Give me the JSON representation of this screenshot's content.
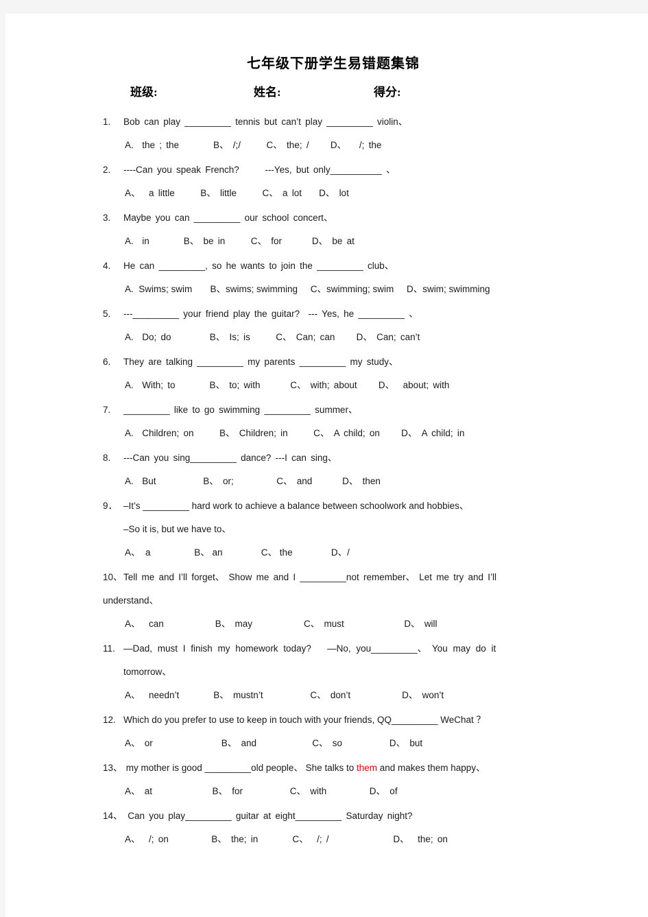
{
  "document": {
    "title": "七年级下册学生易错题集锦",
    "header_fields": {
      "class_label": "班级:",
      "name_label": "姓名:",
      "score_label": "得分:"
    }
  },
  "questions": [
    {
      "number": "1.",
      "stem": "Bob can play _________ tennis but can’t play _________ violin、",
      "options": "A.  the ; the        B、 /;/      C、 the; /     D、   /; the"
    },
    {
      "number": "2.",
      "stem": "----Can you speak French?      ---Yes, but only__________ 、",
      "options": "A、  a little      B、 little      C、 a lot    D、 lot"
    },
    {
      "number": "3.",
      "stem": "Maybe you can _________ our school concert、",
      "options": "A.  in        B、 be in      C、 for       D、 be at"
    },
    {
      "number": "4.",
      "stem": "He can _________, so he wants to join the _________ club、",
      "options": "A.  Swims; swim       B、swims; swimming     C、swimming; swim     D、swim; swimming"
    },
    {
      "number": "5.",
      "stem": "---_________ your friend play the guitar?  --- Yes, he _________ 、",
      "options": "A.  Do; do         B、 Is; is      C、 Can; can     D、 Can; can’t"
    },
    {
      "number": "6.",
      "stem": "They are talking _________ my parents _________ my study、",
      "options": "A.  With; to        B、 to; with       C、 with; about     D、  about; with"
    },
    {
      "number": "7.",
      "stem": "_________ like to go swimming _________ summer、",
      "options": "A.  Children; on      B、 Children; in      C、 A child; on     D、 A child; in"
    },
    {
      "number": "8.",
      "stem": "---Can you sing_________ dance? ---I can sing、",
      "options": "A.  But           B、 or;          C、 and       D、 then"
    },
    {
      "number": "9．",
      "stem": "–It’s _________ hard work to achieve a balance between schoolwork and hobbies、",
      "stem_line2": "–So it is, but we have to、",
      "options": "A、  a                 B、 an               C、 the               D、/"
    },
    {
      "number": "10、",
      "stem": "Tell me and I’ll forget、 Show me and I _________not remember、 Let me try and I’ll",
      "continuation": "understand、",
      "options": "A、  can            B、 may            C、 must              D、 will"
    },
    {
      "number": "11.",
      "stem": "—Dad, must I finish my homework today?   —No, you_________、 You may do it",
      "continuation_indent": "tomorrow、",
      "options": "A、  needn’t        B、 mustn’t           C、 don’t            D、 won’t"
    },
    {
      "number": "12.",
      "stem": "Which do you prefer to use to keep in touch with your friends, QQ_________ WeChat ？",
      "options": "A、 or                B、 and             C、 so           D、 but"
    },
    {
      "number": "13、",
      "stem_part1": " my mother is good _________old people、 She talks to ",
      "stem_highlight": "them",
      "stem_part2": " and makes them happy、",
      "options": "A、 at              B、 for           C、 with          D、 of"
    },
    {
      "number": "14、",
      "stem": " Can you play_________ guitar at eight_________ Saturday night?",
      "options": "A、  /; on          B、 the; in        C、  /; /               D、  the; on"
    }
  ],
  "colors": {
    "page_background": "#ffffff",
    "canvas_background": "#f5f5f5",
    "text": "#1a1a1a",
    "highlight_red": "#ff0000"
  }
}
